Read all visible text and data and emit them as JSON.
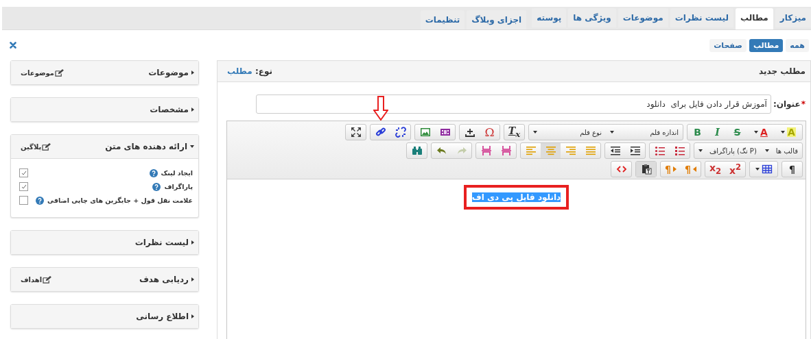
{
  "tab_groups": [
    [
      {
        "label": "میزکار",
        "selected": false
      },
      {
        "label": "مطالب",
        "selected": true
      },
      {
        "label": "لیست نظرات",
        "selected": false
      },
      {
        "label": "موضوعات",
        "selected": false
      },
      {
        "label": "ویژگی ها",
        "selected": false
      },
      {
        "label": "پوسته",
        "selected": false
      }
    ],
    [
      {
        "label": "اجزای وبلاگ",
        "selected": false
      },
      {
        "label": "تنظیمات",
        "selected": false
      }
    ]
  ],
  "sub_nav": [
    {
      "label": "همه",
      "selected": false
    },
    {
      "label": "مطالب",
      "selected": true
    },
    {
      "label": "صفحات",
      "selected": false
    }
  ],
  "sidebar": [
    {
      "title": "موضوعات",
      "expanded": false,
      "action": "موضوعات"
    },
    {
      "title": "مشخصات",
      "expanded": false
    },
    {
      "title": "ارائه دهنده های متن",
      "expanded": true,
      "action": "پلاگین",
      "options": [
        {
          "label": "ایجاد لینک",
          "checked": true
        },
        {
          "label": "پاراگراف",
          "checked": true
        },
        {
          "label": "علامت نقل قول + جایگزین های چاپی اضافی",
          "checked": false
        }
      ]
    },
    {
      "title": "لیست نظرات",
      "expanded": false
    },
    {
      "title": "ردیابی هدف",
      "expanded": false,
      "action": "اهداف"
    },
    {
      "title": "اطلاع رسانی",
      "expanded": false
    }
  ],
  "editor_panel": {
    "title": "مطلب جدید",
    "type_label": "نوع:",
    "type_value": "مطلب",
    "title_field": {
      "label": "عنوان:",
      "required_mark": "*",
      "value": "آموزش قرار دادن فایل برای  دانلود"
    },
    "toolbar": [
      [
        [
          {
            "kind": "bg-color",
            "label": "A",
            "caret": true
          },
          {
            "kind": "text-color",
            "label": "A",
            "caret": true
          },
          {
            "kind": "strike",
            "label": "S"
          },
          {
            "kind": "italic",
            "label": "I"
          },
          {
            "kind": "bold",
            "label": "B"
          }
        ],
        [
          {
            "kind": "dropdown",
            "label": "اندازه قلم"
          },
          {
            "kind": "dropdown",
            "label": "نوع قلم"
          }
        ],
        [
          {
            "kind": "clear-format",
            "label": "T$_{x}$"
          }
        ],
        [
          {
            "kind": "special-char",
            "label": "Ω"
          },
          {
            "kind": "anchor"
          }
        ],
        [
          {
            "kind": "media"
          },
          {
            "kind": "image"
          }
        ],
        [
          {
            "kind": "unlink"
          },
          {
            "kind": "link"
          }
        ],
        [
          {
            "kind": "maximize"
          }
        ]
      ],
      [
        [
          {
            "kind": "dropdown",
            "label": "قالب ها"
          },
          {
            "kind": "dropdown",
            "label": "(P تگ) پاراگراف"
          }
        ],
        [
          {
            "kind": "numbered-list"
          },
          {
            "kind": "bullet-list"
          }
        ],
        [
          {
            "kind": "indent"
          },
          {
            "kind": "outdent"
          }
        ],
        [
          {
            "kind": "align-justify",
            "active": false
          },
          {
            "kind": "align-right",
            "active": false
          },
          {
            "kind": "align-center",
            "active": true
          },
          {
            "kind": "align-left",
            "active": false
          }
        ],
        [
          {
            "kind": "page-break"
          },
          {
            "kind": "page-break"
          }
        ],
        [
          {
            "kind": "redo",
            "disabled": true
          },
          {
            "kind": "undo",
            "disabled": false
          }
        ],
        [
          {
            "kind": "find"
          }
        ]
      ],
      [
        [
          {
            "kind": "blocks",
            "label": "¶"
          }
        ],
        [
          {
            "kind": "table",
            "caret": true
          }
        ],
        [
          {
            "kind": "superscript",
            "label": "x$^{2}$"
          },
          {
            "kind": "subscript",
            "label": "x$_{2}$"
          }
        ],
        [
          {
            "kind": "rtl",
            "label": "¶"
          },
          {
            "kind": "ltr",
            "label": "¶"
          }
        ],
        [
          {
            "kind": "paste-text",
            "active": true
          }
        ],
        [
          {
            "kind": "source"
          }
        ]
      ]
    ],
    "content": {
      "text": "دانلود فایل پی دی  اف",
      "selected": true
    }
  }
}
